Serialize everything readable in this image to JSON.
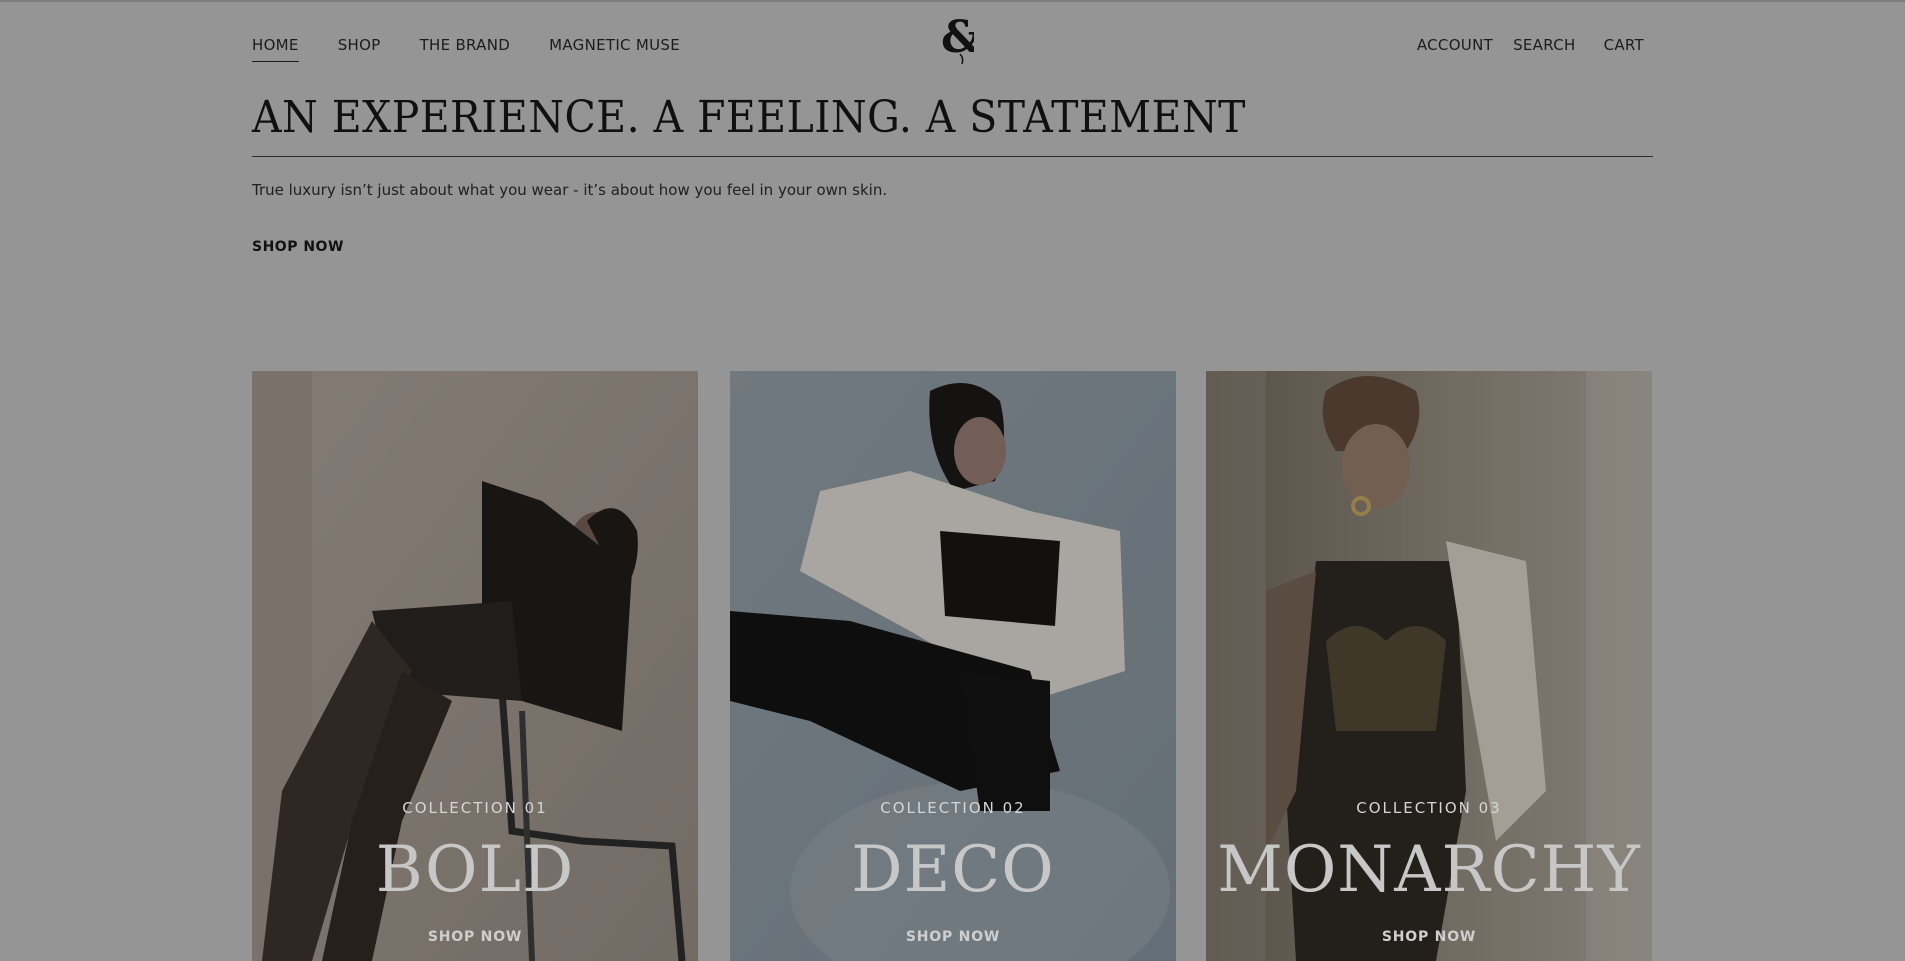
{
  "nav": {
    "items": [
      {
        "label": "HOME",
        "active": true
      },
      {
        "label": "SHOP"
      },
      {
        "label": "THE BRAND"
      },
      {
        "label": "MAGNETIC MUSE"
      }
    ]
  },
  "logo": {
    "glyph": "&",
    "icon": "ampersand-logo-icon"
  },
  "utility": {
    "account": "ACCOUNT",
    "search": "SEARCH",
    "cart": "CART"
  },
  "hero": {
    "headline": "AN EXPERIENCE. A FEELING. A STATEMENT",
    "subtext": "True luxury isn’t just about what you wear - it’s about how you feel in your own skin.",
    "cta": "SHOP NOW"
  },
  "collections": [
    {
      "label": "COLLECTION 01",
      "name": "BOLD",
      "cta": "SHOP NOW"
    },
    {
      "label": "COLLECTION 02",
      "name": "DECO",
      "cta": "SHOP NOW"
    },
    {
      "label": "COLLECTION 03",
      "name": "MONARCHY",
      "cta": "SHOP NOW"
    }
  ],
  "colors": {
    "overlay_bg": "#959595",
    "text": "#1b1b1b"
  }
}
